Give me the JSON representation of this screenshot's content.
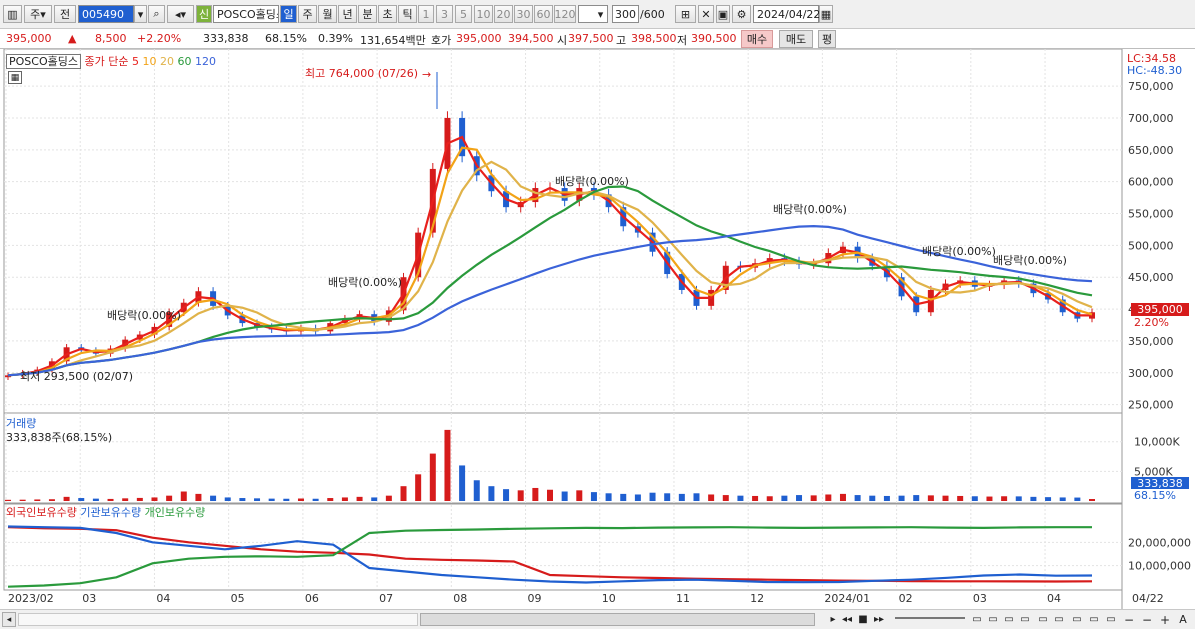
{
  "toolbar": {
    "mode_buttons": [
      "주",
      "전"
    ],
    "code": "005490",
    "name": "POSCO홀딩스",
    "shin": "신",
    "periods": [
      "일",
      "주",
      "월",
      "년",
      "분",
      "초",
      "틱"
    ],
    "intervals": [
      "1",
      "3",
      "5",
      "10",
      "20",
      "30",
      "60",
      "120"
    ],
    "count": "300",
    "max": "/600",
    "date": "2024/04/22"
  },
  "quote": {
    "price": "395,000",
    "change": "8,500",
    "rate": "+2.20%",
    "volume": "333,838",
    "vol_ratio": "68.15%",
    "turnover": "0.39%",
    "amount": "131,654백만",
    "hoga_label": "호가",
    "ask": "395,000",
    "bid": "394,500",
    "open_label": "시",
    "open": "397,500",
    "high_label": "고",
    "high": "398,500",
    "low_label": "저",
    "low": "390,500",
    "buy": "매수",
    "sell": "매도",
    "avg": "평"
  },
  "price_panel": {
    "name": "POSCO홀딩스",
    "ma_label": "종가 단순",
    "ma_periods": [
      "5",
      "10",
      "20",
      "60",
      "120"
    ],
    "max_ann": "최고 764,000 (07/26)",
    "min_ann": "최저 293,500 (02/07)",
    "dividend": "배당락(0.00%)",
    "lc": "LC:34.58",
    "hc": "HC:-48.30",
    "cur_price": "395,000",
    "cur_rate": "2.20%",
    "yticks": [
      "750,000",
      "700,000",
      "650,000",
      "600,000",
      "550,000",
      "500,000",
      "450,000",
      "400,000",
      "350,000",
      "300,000",
      "250,000"
    ]
  },
  "volume_panel": {
    "title": "거래량",
    "value": "333,838주(68.15%)",
    "yticks": [
      "10,000K",
      "5,000K"
    ],
    "cur": "333,838",
    "cur_rate": "68.15%"
  },
  "holding_panel": {
    "series": [
      "외국인보유수량",
      "기관보유수량",
      "개인보유수량"
    ],
    "yticks": [
      "20,000,000",
      "10,000,000"
    ]
  },
  "xaxis": [
    "2023/02",
    "03",
    "04",
    "05",
    "06",
    "07",
    "08",
    "09",
    "10",
    "11",
    "12",
    "2024/01",
    "02",
    "03",
    "04",
    "04/22"
  ],
  "colors": {
    "up": "#d61b1b",
    "down": "#1f5fd0",
    "ma5": "#e8201c",
    "ma10": "#f2a317",
    "ma20": "#e0b34a",
    "ma60": "#2a9a3c",
    "ma120": "#3b63d9"
  },
  "chart_data": {
    "type": "candlestick",
    "title": "POSCO홀딩스",
    "ylim": [
      240000,
      780000
    ],
    "close": [
      296000,
      300000,
      305000,
      318000,
      340000,
      335000,
      330000,
      338000,
      352000,
      360000,
      372000,
      395000,
      410000,
      428000,
      405000,
      390000,
      378000,
      372000,
      368000,
      365000,
      370000,
      365000,
      378000,
      385000,
      392000,
      380000,
      398000,
      450000,
      520000,
      620000,
      700000,
      640000,
      610000,
      585000,
      560000,
      568000,
      590000,
      590000,
      570000,
      590000,
      580000,
      560000,
      530000,
      520000,
      490000,
      455000,
      430000,
      405000,
      430000,
      468000,
      465000,
      472000,
      480000,
      475000,
      470000,
      472000,
      488000,
      498000,
      480000,
      468000,
      450000,
      420000,
      395000,
      430000,
      440000,
      445000,
      435000,
      438000,
      445000,
      440000,
      425000,
      415000,
      395000,
      385000,
      395000
    ],
    "volume_k": [
      200,
      220,
      260,
      300,
      700,
      500,
      400,
      350,
      450,
      520,
      600,
      900,
      1600,
      1200,
      900,
      600,
      500,
      450,
      400,
      380,
      420,
      380,
      500,
      600,
      700,
      600,
      900,
      2500,
      4500,
      8000,
      12000,
      6000,
      3500,
      2500,
      2000,
      1800,
      2200,
      1900,
      1600,
      1800,
      1500,
      1300,
      1200,
      1100,
      1400,
      1300,
      1200,
      1300,
      1100,
      1000,
      900,
      850,
      800,
      900,
      1000,
      950,
      1100,
      1200,
      1000,
      900,
      850,
      900,
      1000,
      950,
      900,
      850,
      800,
      750,
      800,
      780,
      700,
      650,
      600,
      580,
      334
    ],
    "foreign_hold": [
      26500000,
      26000000,
      25800000,
      25200000,
      22000000,
      20000000,
      18500000,
      17000000,
      16000000,
      15500000,
      14800000,
      13000000,
      12500000,
      12200000,
      11800000,
      6000000,
      5500000,
      5000000,
      4700000,
      4400000,
      4200000,
      4000000,
      3800000,
      3600000,
      3500000,
      3400000,
      3300000,
      3300000,
      3250000,
      3200000,
      3300000
    ],
    "inst_hold": [
      26800000,
      26500000,
      26200000,
      24000000,
      20000000,
      18500000,
      17000000,
      18500000,
      20500000,
      19000000,
      9000000,
      7500000,
      6000000,
      5000000,
      4000000,
      3200000,
      2800000,
      3300000,
      3800000,
      4000000,
      3500000,
      3000000,
      2900000,
      3000000,
      3500000,
      4000000,
      4800000,
      5800000,
      6200000,
      5700000,
      5800000
    ],
    "indiv_hold": [
      1000000,
      1500000,
      2500000,
      5000000,
      11000000,
      13000000,
      13800000,
      14000000,
      13800000,
      14500000,
      24000000,
      25000000,
      25300000,
      25500000,
      25800000,
      26000000,
      26200000,
      26100000,
      26300000,
      26400000,
      26500000,
      26300000,
      26200000,
      26300000,
      26400000,
      26500000,
      26300000,
      26200000,
      26400000,
      26500000,
      26500000
    ]
  }
}
